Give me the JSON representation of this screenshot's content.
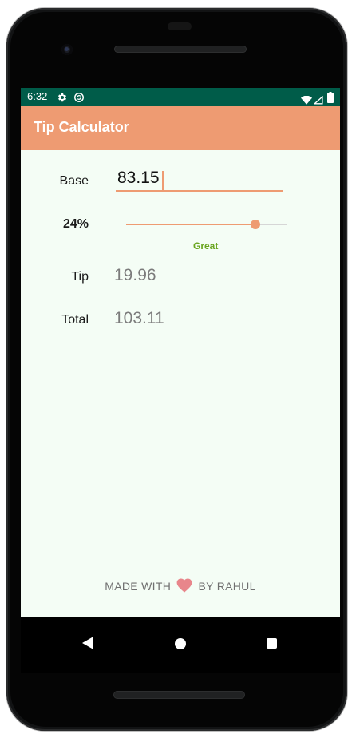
{
  "status_bar": {
    "time": "6:32"
  },
  "app_bar": {
    "title": "Tip Calculator"
  },
  "form": {
    "base_label": "Base",
    "base_value": "83.15",
    "tip_percent_label": "24%",
    "tip_percent": 24,
    "tip_percent_max": 30,
    "tip_quality": "Great",
    "tip_label": "Tip",
    "tip_value": "19.96",
    "total_label": "Total",
    "total_value": "103.11"
  },
  "footer": {
    "made_with": "MADE WITH",
    "by": "BY RAHUL"
  },
  "colors": {
    "accent": "#ee9b72",
    "status_bar": "#005c49",
    "background": "#f4fdf5",
    "quality_great": "#6aa51f",
    "heart": "#e8868b"
  },
  "icons": {
    "status": [
      "gear-icon",
      "sync-icon",
      "wifi-icon",
      "signal-icon",
      "battery-icon"
    ],
    "footer": "heart-icon",
    "nav": [
      "back-icon",
      "home-icon",
      "recent-apps-icon"
    ]
  }
}
